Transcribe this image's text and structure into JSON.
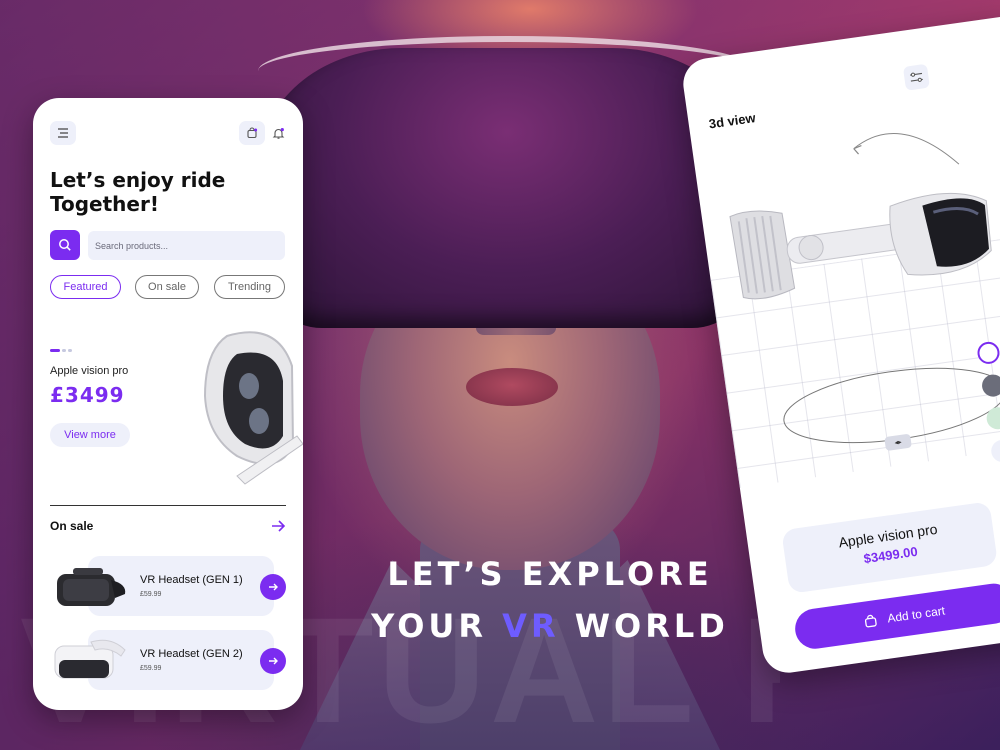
{
  "hero": {
    "line1": "LET’S EXPLORE",
    "line2_prefix": "YOUR ",
    "line2_highlight": "VR",
    "line2_suffix": " WORLD",
    "background_word": "VIRTUAL REALITY"
  },
  "left_phone": {
    "menu_icon": "menu-icon",
    "cart_icon": "cart-icon",
    "bell_icon": "bell-icon",
    "title_line1": "Let’s enjoy ride",
    "title_line2": "Together!",
    "search": {
      "placeholder": "Search products...",
      "icon": "search-icon"
    },
    "tabs": [
      {
        "label": "Featured",
        "active": true
      },
      {
        "label": "On sale",
        "active": false
      },
      {
        "label": "Trending",
        "active": false
      }
    ],
    "featured": {
      "name": "Apple vision pro",
      "price": "£3499",
      "button": "View more"
    },
    "on_sale": {
      "heading": "On sale",
      "arrow_icon": "arrow-right-icon",
      "items": [
        {
          "name": "VR Headset (GEN 1)",
          "price": "£59.99"
        },
        {
          "name": "VR Headset (GEN 2)",
          "price": "£59.99"
        }
      ]
    }
  },
  "right_phone": {
    "title": "3d view",
    "filter_icon": "sliders-icon",
    "rotate_handle": "◂▸",
    "colors": [
      "#ffffff",
      "#6b6d7a",
      "#cfead7",
      "#eef0fa"
    ],
    "selected_color_accent": "#7b2cf0",
    "product": {
      "name": "Apple vision pro",
      "price": "$3499.00"
    },
    "add_to_cart": "Add to cart",
    "bag_icon": "bag-icon"
  },
  "colors": {
    "accent": "#7b2cf0",
    "vr_highlight": "#6e5cff",
    "chip_bg": "#eef0fa"
  }
}
